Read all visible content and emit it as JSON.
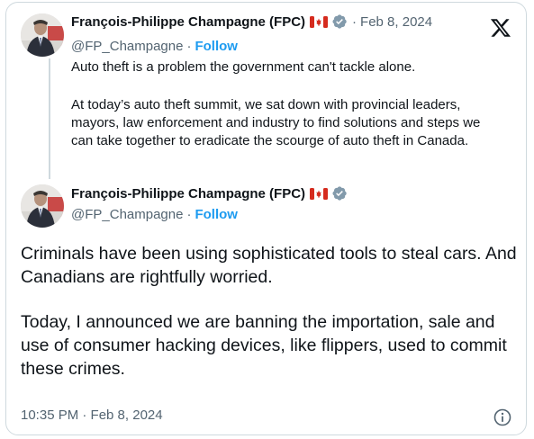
{
  "tweet1": {
    "author_name": "François-Philippe Champagne (FPC)",
    "flag_icon": "canada-flag-icon",
    "verified_icon": "verified-badge-icon",
    "separator": "·",
    "date": "Feb 8, 2024",
    "handle": "@FP_Champagne",
    "handle_separator": "·",
    "follow_label": "Follow",
    "text_line1": "Auto theft is a problem the government can't tackle alone.",
    "text_para2": "At today’s auto theft summit, we sat down with provincial leaders, mayors, law enforcement and industry to find solutions and steps we can take together to eradicate the scourge of auto theft in Canada."
  },
  "tweet2": {
    "author_name": "François-Philippe Champagne (FPC)",
    "handle": "@FP_Champagne",
    "handle_separator": "·",
    "follow_label": "Follow",
    "text_para1": "Criminals have been using sophisticated tools to steal cars. And Canadians are rightfully worried.",
    "text_para2": "Today, I announced we are banning the importation, sale and use of consumer hacking devices, like flippers, used to commit these crimes.",
    "timestamp": "10:35 PM · Feb 8, 2024"
  },
  "colors": {
    "text_primary": "#0f1419",
    "text_secondary": "#536471",
    "link_blue": "#1d9bf0",
    "border": "#cfd9de",
    "verified_gray": "#829aab",
    "flag_red": "#d52b1e"
  },
  "icons": {
    "x_logo": "x-logo-icon",
    "info": "info-icon"
  }
}
